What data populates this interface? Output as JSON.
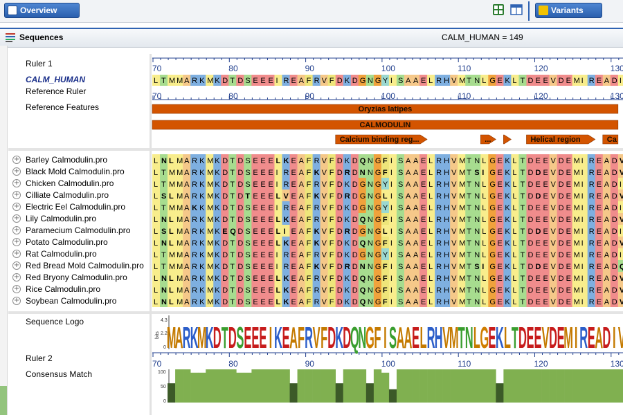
{
  "toolbar": {
    "overview_label": "Overview",
    "variants_label": "Variants",
    "icons": [
      "grid-icon",
      "window-icon",
      "variants-icon"
    ]
  },
  "panel": {
    "title": "Sequences",
    "reference_readout": "CALM_HUMAN = 149"
  },
  "track_labels": {
    "ruler1": "Ruler 1",
    "reference_name": "CALM_HUMAN",
    "reference_ruler": "Reference Ruler",
    "reference_features": "Reference Features",
    "sequence_logo": "Sequence Logo",
    "ruler2": "Ruler 2",
    "consensus_match": "Consensus Match",
    "logo_axis_label": "bits",
    "logo_ticks": [
      "4.3",
      "2.2",
      "0"
    ],
    "consensus_ticks": [
      "100",
      "50",
      "0"
    ]
  },
  "ruler_ticks": [
    "70",
    "80",
    "90",
    "100",
    "110",
    "120",
    "130"
  ],
  "ruler_start": 70,
  "reference_sequence": "LTMMARKMKDTDSEEEIREAFRVFDKDGNGYISAAELRHVMTNLGEKLTDEEVDEMIREADI",
  "features": [
    {
      "label": "Oryzias latipes",
      "start": 70,
      "end": 131,
      "row": 0
    },
    {
      "label": "CALMODULIN",
      "start": 70,
      "end": 131,
      "row": 1
    },
    {
      "label": "Calcium binding reg...",
      "start": 94,
      "end": 106,
      "row": 2,
      "arrow": true
    },
    {
      "label": "...",
      "start": 113,
      "end": 115,
      "row": 2,
      "arrow": true
    },
    {
      "label": "",
      "start": 116,
      "end": 117,
      "row": 2,
      "arrow": true
    },
    {
      "label": "Helical region",
      "start": 119,
      "end": 128,
      "row": 2,
      "arrow": true
    },
    {
      "label": "Ca",
      "start": 129,
      "end": 131,
      "row": 2
    }
  ],
  "sequences": [
    {
      "name": "Barley Calmodulin.pro",
      "seq": "LNLMARKMKDTDSEEELKEAFRVFDKDQNGFISAAELRHVMTNLGEKLTDEEVDEMIREADV"
    },
    {
      "name": "Black Mold Calmodulin.pro",
      "seq": "LTMMARKMKDTDSEEEIREAFKVFDRDNNGFISAAELRHVMTSIGEKLTDDEVDEMIREADV"
    },
    {
      "name": "Chicken Calmodulin.pro",
      "seq": "LTMMARKMKDTDSEEEIREAFRVFDKDGNGYISAAELRHVMTNLGEKLTDEEVDEMIREADI"
    },
    {
      "name": "Cilliate Calmodulin.pro",
      "seq": "LSLMARKMKDTDTEEELVEAFKVFDRDGNGLISAAELRHVMTNLGEKLTDDEVDEMIREADV"
    },
    {
      "name": "Electric Eel Calmodulin.pro",
      "seq": "LTMMAKKMKDTDSEEEIREAFRVFDKDGNGYISAAELRHVMTNLGEKLTDEEVDEMIREADI"
    },
    {
      "name": "Lily Calmodulin.pro",
      "seq": "LNLMARKMKDTDSEEELKEAFRVFDKDQNGFISAAELRHVMTNLGEKLTDEEVDEMIREADV"
    },
    {
      "name": "Paramecium Calmodulin.pro",
      "seq": "LSLMARKMKEQDSEEELIEAFKVFDRDGNGLISAAELRHVMTNLGEKLTDDEVDEMIREADI"
    },
    {
      "name": "Potato Calmodulin.pro",
      "seq": "LNLMARKMKDTDSEEELKEAFKVFDKDQNGFISAAELRHVMTNLGEKLTDEEVDEMIREADV"
    },
    {
      "name": "Rat Calmodulin.pro",
      "seq": "LTMMARKMKDTDSEEEIREAFRVFDKDGNGYISAAELRHVMTNLGEKLTDEEVDEMIREADI"
    },
    {
      "name": "Red Bread Mold Calmodulin.pro",
      "seq": "LTMMARKMKDTDSEEEIREAFKVFDRDNNGFISAAELRHVMTSIGEKLTDDEVDEMIREADQ"
    },
    {
      "name": "Red Bryony Calmodulin.pro",
      "seq": "LNLMARKMKDTDSEEELKEAFRVFDKDQNGFISAAELRHVMTNLGEKLTDEEVDEMIREADV"
    },
    {
      "name": "Rice Calmodulin.pro",
      "seq": "LNLMARKMKDTDSEEELKEAFRVFDKDQNGFISAAELRHVMTNLGEKLTDEEVDEMIREADV"
    },
    {
      "name": "Soybean Calmodulin.pro",
      "seq": "LNLMARKMKDTDSEEELKEAFRVFDKDQNGFISAAELRHVMTNLGEKLTDEEVDEMIREADV"
    }
  ],
  "logo_columns": [
    "",
    "M",
    "A",
    "R",
    "K",
    "M",
    "K",
    "D",
    "T",
    "D",
    "S",
    "E",
    "E",
    "E",
    "I",
    "K",
    "E",
    "A",
    "F",
    "R",
    "V",
    "F",
    "D",
    "K",
    "D",
    "Q",
    "N",
    "G",
    "F",
    "I",
    "S",
    "A",
    "A",
    "E",
    "L",
    "R",
    "H",
    "V",
    "M",
    "T",
    "N",
    "L",
    "G",
    "E",
    "K",
    "L",
    "T",
    "D",
    "E",
    "E",
    "V",
    "D",
    "E",
    "M",
    "I",
    "R",
    "E",
    "A",
    "D",
    "I",
    "V"
  ],
  "consensus_match_pct": [
    58,
    100,
    100,
    90,
    90,
    100,
    100,
    100,
    100,
    90,
    90,
    100,
    100,
    100,
    100,
    100,
    58,
    100,
    100,
    100,
    100,
    100,
    58,
    100,
    100,
    100,
    58,
    100,
    90,
    40,
    100,
    100,
    100,
    100,
    100,
    100,
    100,
    100,
    100,
    100,
    100,
    100,
    100,
    58,
    100,
    100,
    100,
    100,
    100,
    100,
    100,
    100,
    100,
    100,
    100,
    100,
    100,
    100,
    100,
    100,
    100,
    100,
    58
  ],
  "colors": {
    "accent": "#2f63b3",
    "feature": "#d35400",
    "consensus_high": "#80b050",
    "consensus_low": "#3c5a28"
  }
}
